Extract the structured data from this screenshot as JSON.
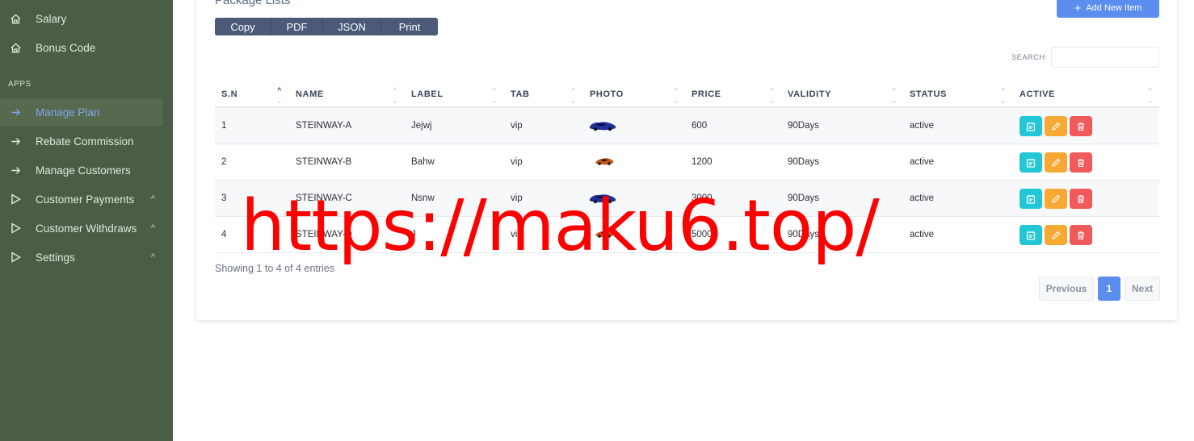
{
  "sidebar": {
    "items_top": [
      {
        "label": "Salary",
        "icon": "home-icon"
      },
      {
        "label": "Bonus Code",
        "icon": "home-icon"
      }
    ],
    "section_label": "APPS",
    "items": [
      {
        "label": "Manage Plan",
        "icon": "arrow-right-icon",
        "active": true
      },
      {
        "label": "Rebate Commission",
        "icon": "arrow-right-icon"
      },
      {
        "label": "Manage Customers",
        "icon": "arrow-right-icon"
      },
      {
        "label": "Customer Payments",
        "icon": "triangle-right-icon",
        "chevron": "^"
      },
      {
        "label": "Customer Withdraws",
        "icon": "triangle-right-icon",
        "chevron": "^"
      },
      {
        "label": "Settings",
        "icon": "triangle-right-icon",
        "chevron": "^"
      }
    ]
  },
  "main": {
    "title": "Package Lists",
    "add_button": "Add New Item",
    "export_buttons": [
      "Copy",
      "PDF",
      "JSON",
      "Print"
    ],
    "search_label": "SEARCH:",
    "search_value": "",
    "columns": [
      "S.N",
      "NAME",
      "LABEL",
      "TAB",
      "PHOTO",
      "PRICE",
      "VALIDITY",
      "STATUS",
      "ACTIVE"
    ],
    "rows": [
      {
        "sn": "1",
        "name": "STEINWAY-A",
        "label": "Jejwj",
        "tab": "vip",
        "photo": "blue-car",
        "price": "600",
        "validity": "90Days",
        "status": "active"
      },
      {
        "sn": "2",
        "name": "STEINWAY-B",
        "label": "Bahw",
        "tab": "vip",
        "photo": "orange-car",
        "price": "1200",
        "validity": "90Days",
        "status": "active"
      },
      {
        "sn": "3",
        "name": "STEINWAY-C",
        "label": "Nsnw",
        "tab": "vip",
        "photo": "blue-car",
        "price": "3000",
        "validity": "90Days",
        "status": "active"
      },
      {
        "sn": "4",
        "name": "STEINWAY-D",
        "label": "J",
        "tab": "vip",
        "photo": "orange-car",
        "price": "5000",
        "validity": "90Days",
        "status": "active"
      }
    ],
    "showing_text": "Showing 1 to 4 of 4 entries",
    "pagination": {
      "previous": "Previous",
      "current": "1",
      "next": "Next"
    }
  },
  "watermark": "https://maku6.top/",
  "colors": {
    "sidebar_bg": "#4b5e45",
    "accent": "#5b8def",
    "view_button": "#22c7d6",
    "edit_button": "#f7a934",
    "delete_button": "#f05a5a",
    "watermark": "#ff0000"
  }
}
